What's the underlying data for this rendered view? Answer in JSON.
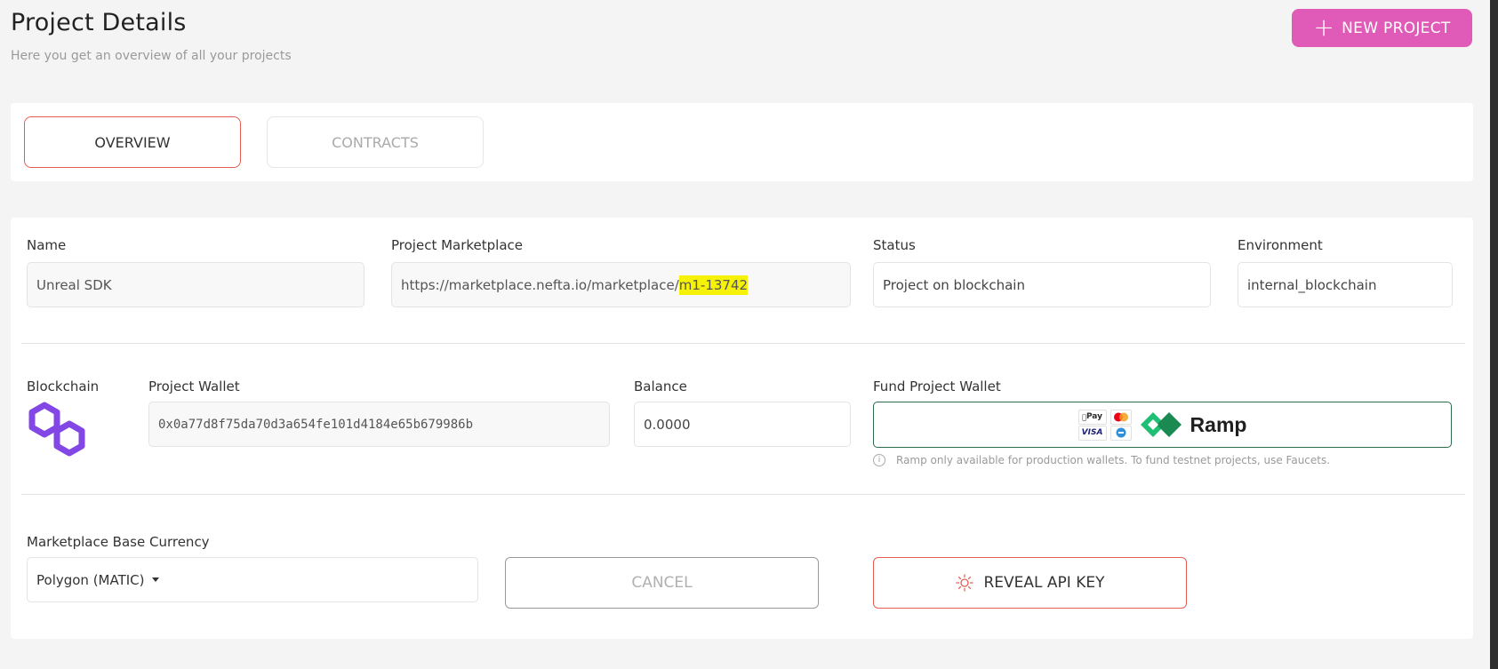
{
  "header": {
    "title": "Project Details",
    "subtitle": "Here you get an overview of all your projects",
    "new_project_label": "NEW PROJECT",
    "new_project_icon": "plus-icon",
    "accent_color": "#e05ab7"
  },
  "tabs": [
    {
      "label": "OVERVIEW",
      "active": true
    },
    {
      "label": "CONTRACTS",
      "active": false
    }
  ],
  "details": {
    "name_label": "Name",
    "name_value": "Unreal SDK",
    "marketplace_label": "Project Marketplace",
    "marketplace_url_prefix": "https://marketplace.nefta.io/marketplace/",
    "marketplace_url_id": "m1-13742",
    "status_label": "Status",
    "status_value": "Project on blockchain",
    "environment_label": "Environment",
    "environment_value": "internal_blockchain"
  },
  "wallet": {
    "blockchain_label": "Blockchain",
    "blockchain_icon": "polygon-icon",
    "wallet_label": "Project Wallet",
    "wallet_value": "0x0a77d8f75da70d3a654fe101d4184e65b679986b",
    "balance_label": "Balance",
    "balance_value": "0.0000",
    "fund_label": "Fund Project Wallet",
    "ramp_brand": "Ramp",
    "pay_methods": [
      "Pay",
      "VISA"
    ],
    "ramp_note": "Ramp only available for production wallets. To fund testnet projects, use Faucets."
  },
  "currency": {
    "label": "Marketplace Base Currency",
    "selected": "Polygon (MATIC)"
  },
  "actions": {
    "cancel_label": "CANCEL",
    "reveal_label": "REVEAL API KEY",
    "reveal_icon": "sun-icon"
  }
}
